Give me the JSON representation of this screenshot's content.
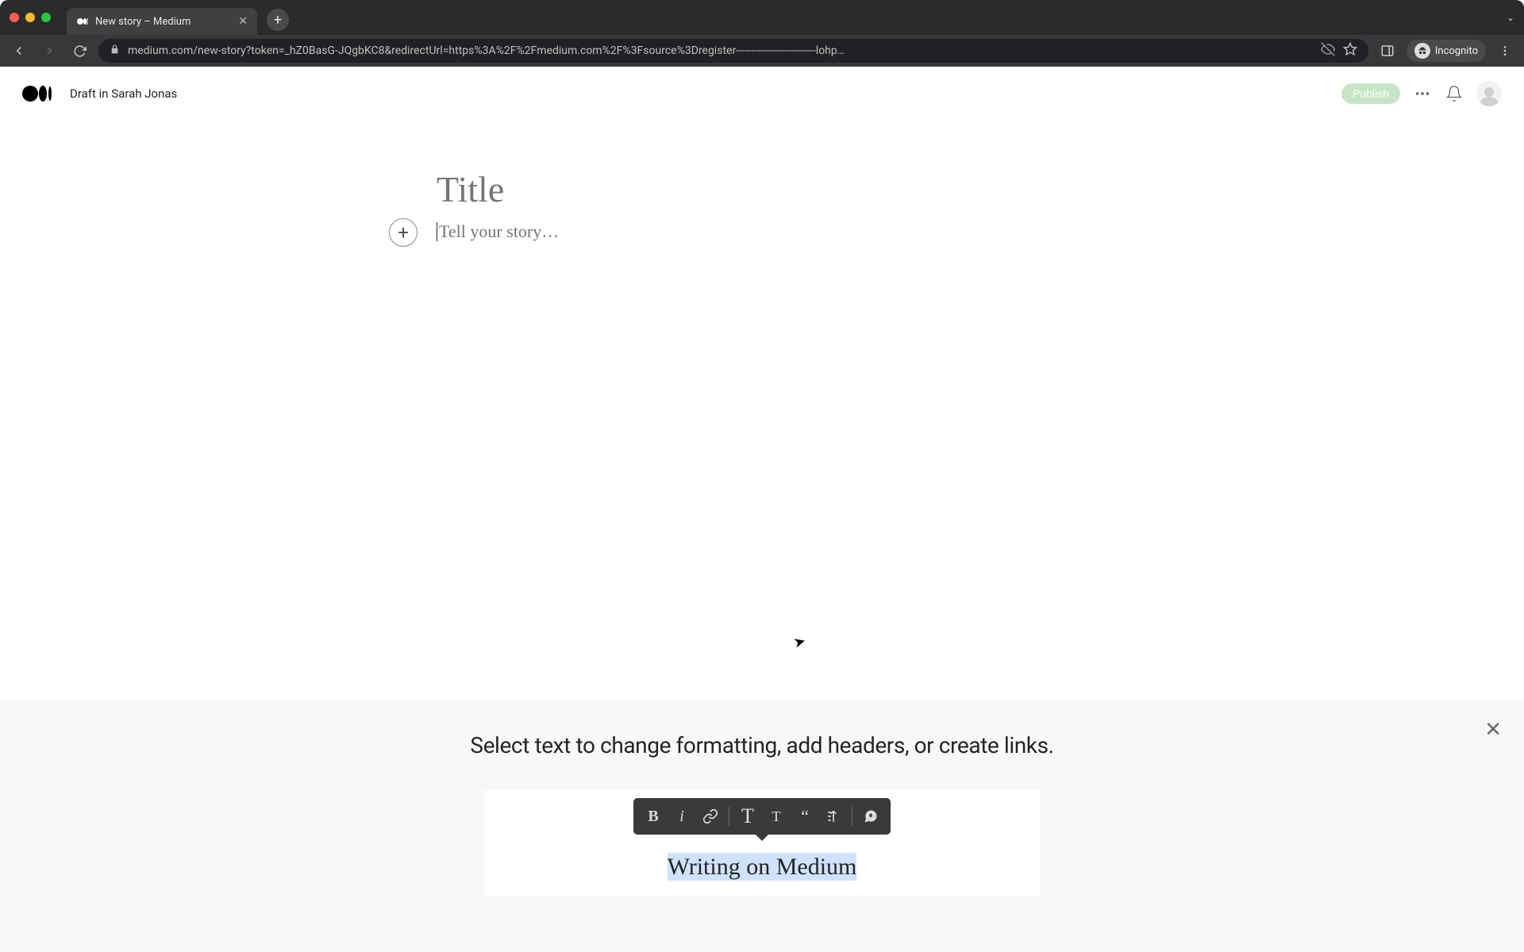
{
  "browser": {
    "tab_title": "New story – Medium",
    "url": "medium.com/new-story?token=_hZ0BasG-JQgbKC8&redirectUrl=https%3A%2F%2Fmedium.com%2F%3Fsource%3Dregister--------------------------lohp…",
    "incognito_label": "Incognito"
  },
  "header": {
    "draft_label": "Draft in Sarah Jonas",
    "publish_label": "Publish"
  },
  "editor": {
    "title_placeholder": "Title",
    "body_placeholder": "Tell your story…"
  },
  "tip": {
    "message": "Select text to change formatting, add headers, or create links.",
    "demo_text": "Writing on Medium",
    "toolbar": {
      "bold": "B",
      "italic": "i",
      "big_t": "T",
      "small_t": "T",
      "quote": "“"
    }
  }
}
